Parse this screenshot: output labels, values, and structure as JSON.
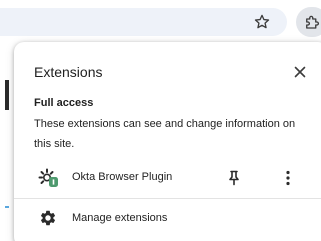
{
  "toolbar": {
    "bookmark_icon": "star-outline-icon",
    "extensions_icon": "puzzle-piece-icon"
  },
  "popup": {
    "title": "Extensions",
    "close_icon": "close-icon",
    "section": {
      "heading": "Full access",
      "description": "These extensions can see and change information on this site."
    },
    "extensions": [
      {
        "name": "Okta Browser Plugin",
        "icon": "okta-plugin-icon",
        "pin_icon": "pin-icon",
        "more_icon": "more-vertical-icon"
      }
    ],
    "manage": {
      "label": "Manage extensions",
      "icon": "gear-icon"
    }
  },
  "colors": {
    "text": "#1f1f1f",
    "omnibox_bg": "#eef2f9",
    "toolbar_button_bg": "#e2e5ea",
    "divider": "#e3e3e3",
    "okta_badge": "#4e9a6e"
  }
}
